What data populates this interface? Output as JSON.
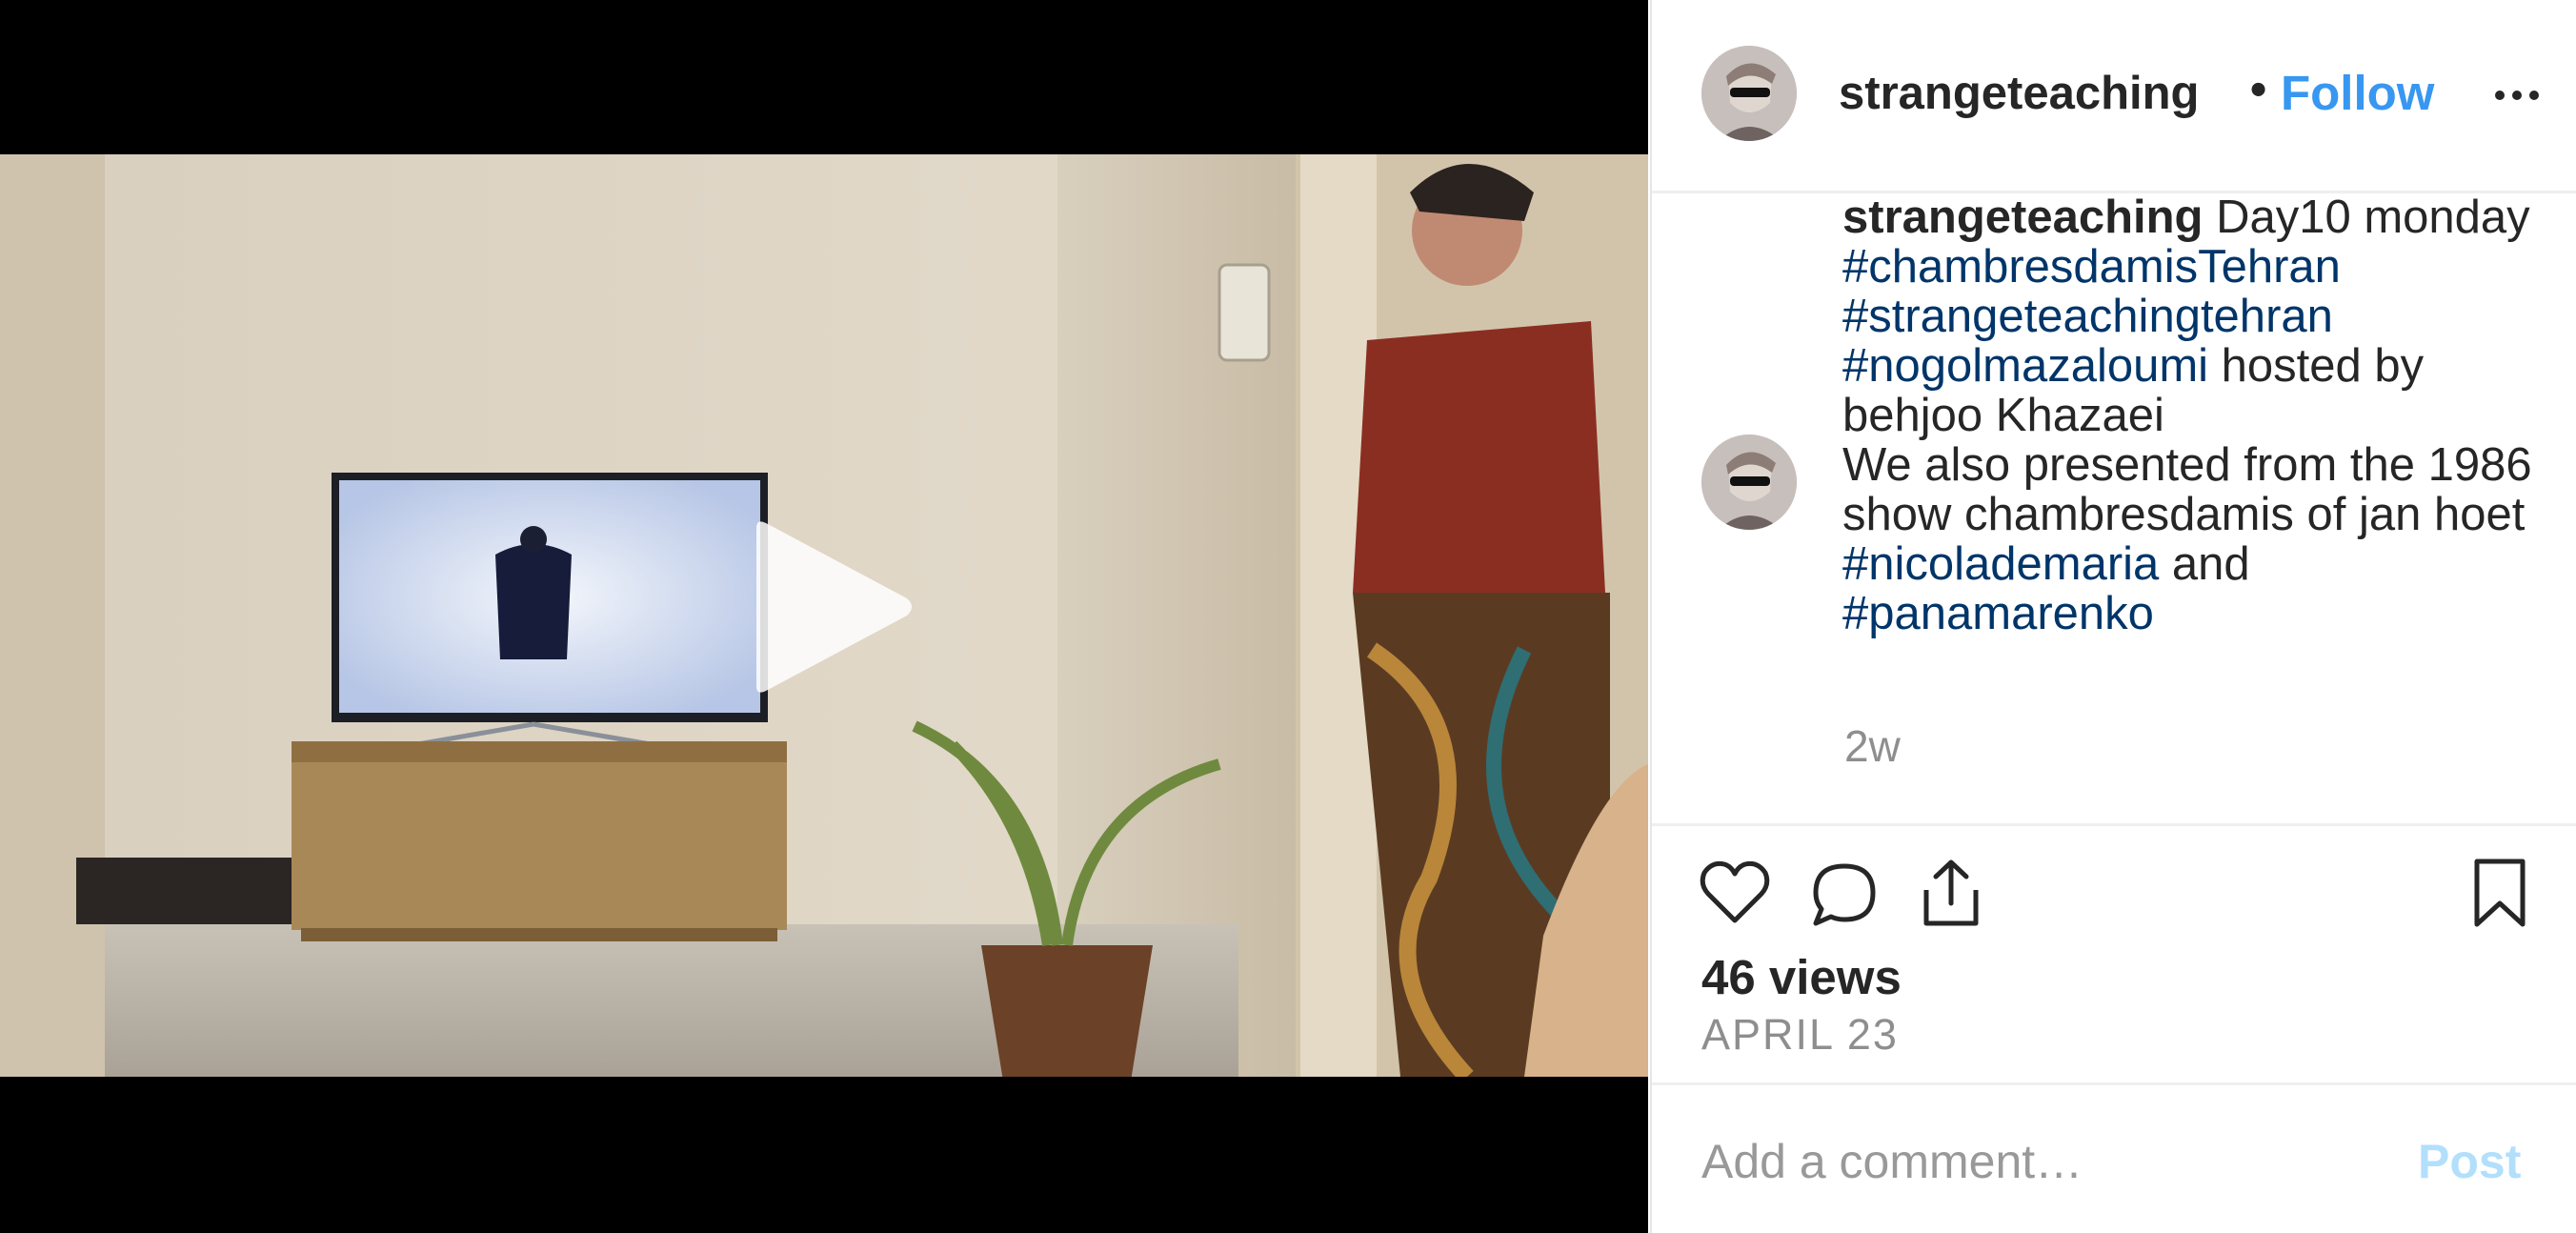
{
  "post": {
    "username": "strangeteaching",
    "follow_label": "Follow",
    "separator": "•",
    "caption": {
      "author": "strangeteaching",
      "text_1": " Day10 monday ",
      "tag_1": "#chambresdamisTehran",
      "tag_2": "#strangeteachingtehran",
      "tag_3": "#nogolmazaloumi",
      "text_2": " hosted by behjoo Khazaei",
      "text_3": "We also presented from the 1986 show chambresdamis of jan hoet ",
      "tag_4": "#nicolademaria",
      "text_4": " and ",
      "tag_5": "#panamarenko"
    },
    "time_ago": "2w",
    "views": "46 views",
    "date": "APRIL 23"
  },
  "comment_box": {
    "placeholder": "Add a comment…",
    "post_label": "Post"
  },
  "icons": {
    "play": "play-icon",
    "like": "heart-icon",
    "comment": "comment-icon",
    "share": "share-icon",
    "save": "bookmark-icon",
    "more": "more-icon"
  },
  "colors": {
    "follow": "#3897f0",
    "hashtag": "#003569",
    "post_disabled": "#b2dffc",
    "secondary_text": "#8e8e8e"
  }
}
